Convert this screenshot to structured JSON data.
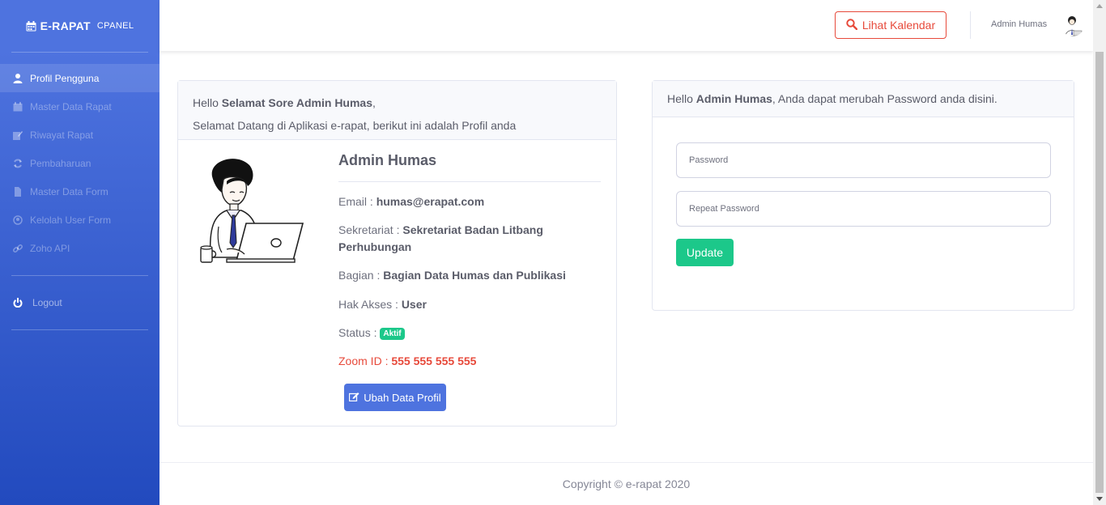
{
  "sidebar": {
    "brand_title": "E-RAPAT",
    "brand_sub": "CPANEL",
    "items": [
      {
        "label": "Profil Pengguna",
        "icon": "user-icon"
      },
      {
        "label": "Master Data Rapat",
        "icon": "calendar-icon"
      },
      {
        "label": "Riwayat Rapat",
        "icon": "edit-icon"
      },
      {
        "label": "Pembaharuan",
        "icon": "sync-icon"
      },
      {
        "label": "Master Data Form",
        "icon": "file-icon"
      },
      {
        "label": "Kelolah User Form",
        "icon": "user-circle-icon"
      },
      {
        "label": "Zoho API",
        "icon": "link-icon"
      }
    ],
    "logout_label": "Logout"
  },
  "topbar": {
    "calendar_button": "Lihat Kalendar",
    "user_name": "Admin Humas"
  },
  "profile_card": {
    "greeting_prefix": "Hello ",
    "greeting_bold": "Selamat Sore Admin Humas",
    "greeting_suffix": ",",
    "welcome": "Selamat Datang di Aplikasi e-rapat, berikut ini adalah Profil anda",
    "name": "Admin Humas",
    "email_label": "Email : ",
    "email": "humas@erapat.com",
    "sekretariat_label": "Sekretariat : ",
    "sekretariat": "Sekretariat Badan Litbang Perhubungan",
    "bagian_label": "Bagian : ",
    "bagian": "Bagian Data Humas dan Publikasi",
    "hak_akses_label": "Hak Akses : ",
    "hak_akses": "User",
    "status_label": "Status : ",
    "status": "Aktif",
    "zoom_label": "Zoom ID : ",
    "zoom_id": "555 555 555 555",
    "edit_button": "Ubah Data Profil"
  },
  "password_card": {
    "hello": "Hello ",
    "name_bold": "Admin Humas",
    "message": ", Anda dapat merubah Password anda disini.",
    "password_placeholder": "Password",
    "repeat_placeholder": "Repeat Password",
    "update_button": "Update"
  },
  "footer": {
    "copyright": "Copyright © e-rapat 2020"
  },
  "colors": {
    "primary": "#4e73df",
    "success": "#1cc88a",
    "danger": "#e74a3b"
  }
}
